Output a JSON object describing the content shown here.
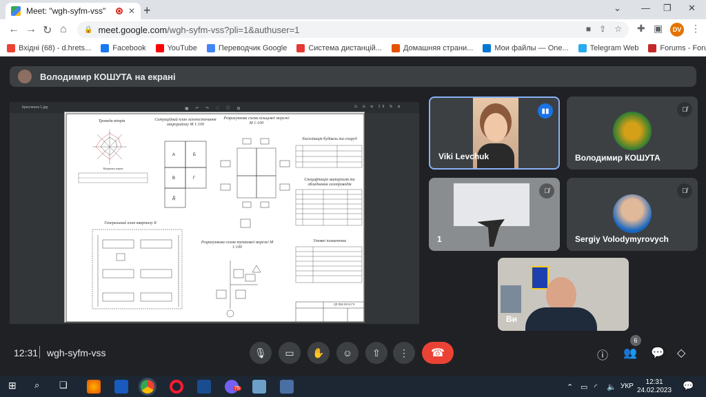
{
  "browser": {
    "tab_title": "Meet: \"wgh-syfm-vss\"",
    "new_tab": "+",
    "url_host": "meet.google.com",
    "url_path": "/wgh-syfm-vss?pli=1&authuser=1",
    "profile_initials": "DV",
    "bookmarks": [
      {
        "label": "Вхідні (68) - d.hrets...",
        "color": "#ea4335"
      },
      {
        "label": "Facebook",
        "color": "#1877f2"
      },
      {
        "label": "YouTube",
        "color": "#ff0000"
      },
      {
        "label": "Переводчик Google",
        "color": "#4285f4"
      },
      {
        "label": "Система дистанцій...",
        "color": "#e53935"
      },
      {
        "label": "Домашняя страни...",
        "color": "#e65100"
      },
      {
        "label": "Мои файлы — One...",
        "color": "#0078d4"
      },
      {
        "label": "Telegram Web",
        "color": "#2aabee"
      },
      {
        "label": "Forums - Forumua....",
        "color": "#c62828"
      }
    ]
  },
  "meet": {
    "presenter_banner": "Володимир КОШУТА на екрані",
    "presentation": {
      "viewer_title": "Креслення 1.jpg",
      "zoom": "28 %",
      "sheet_labels": {
        "rose": "Троянда вітрів",
        "situation": "Ситуаційний план газопостачання мікрорайону М 1:100",
        "ring": "Розрахункова схема кільцевої мережі М 1:100",
        "buildings": "Експлікація будівель та споруд",
        "materials": "Специфікація матеріалів та обладнання газопроводів",
        "general": "Генеральний план кварталу Б",
        "dead_end": "Розрахункова схема тупикової мережі М 1:100",
        "legend": "Умовні позначення",
        "directions": "Напрямки вітрів",
        "stamp": "ДП ПВ2 НІ 04 ГЧ"
      }
    },
    "participants": [
      {
        "name": "Viki Levchuk",
        "mic": "speaking"
      },
      {
        "name": "Володимир КОШУТА",
        "mic": "muted"
      },
      {
        "name": "1",
        "mic": "muted"
      },
      {
        "name": "Sergiy Volodymyrovych",
        "mic": "muted"
      },
      {
        "name": "Ви",
        "mic": "none"
      }
    ],
    "time": "12:31",
    "meeting_code": "wgh-syfm-vss",
    "people_count": "6"
  },
  "taskbar": {
    "language": "УКР",
    "time": "12:31",
    "date": "24.02.2023",
    "viber_badge": "75"
  }
}
